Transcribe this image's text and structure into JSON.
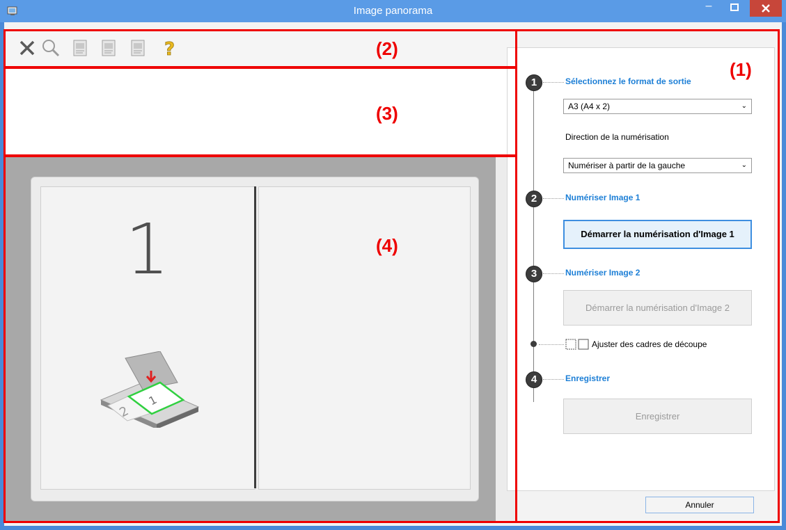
{
  "window": {
    "title": "Image panorama"
  },
  "titlebar_buttons": {
    "minimize": "–",
    "maximize": "□",
    "close": "✕"
  },
  "toolbar": {
    "icons": [
      "close-icon",
      "zoom-icon",
      "image-a-icon",
      "image-b-icon",
      "image-c-icon",
      "help-icon"
    ]
  },
  "annotations": {
    "a1": "(1)",
    "a2": "(2)",
    "a3": "(3)",
    "a4": "(4)"
  },
  "preview": {
    "page_number": "1"
  },
  "steps": {
    "s1": {
      "number": "1",
      "label": "Sélectionnez le format de sortie"
    },
    "format_value": "A3 (A4 x 2)",
    "direction_label": "Direction de la numérisation",
    "direction_value": "Numériser à partir de la gauche",
    "s2": {
      "number": "2",
      "label": "Numériser Image 1",
      "button": "Démarrer la numérisation d'Image 1"
    },
    "s3": {
      "number": "3",
      "label": "Numériser Image 2",
      "button": "Démarrer la numérisation d'Image 2"
    },
    "crop_label": "Ajuster des cadres de découpe",
    "s4": {
      "number": "4",
      "label": "Enregistrer",
      "button": "Enregistrer"
    }
  },
  "footer": {
    "cancel": "Annuler"
  },
  "colors": {
    "accent": "#1d7fd6",
    "annotation": "#ee0000",
    "titlebar": "#5a9be6"
  }
}
